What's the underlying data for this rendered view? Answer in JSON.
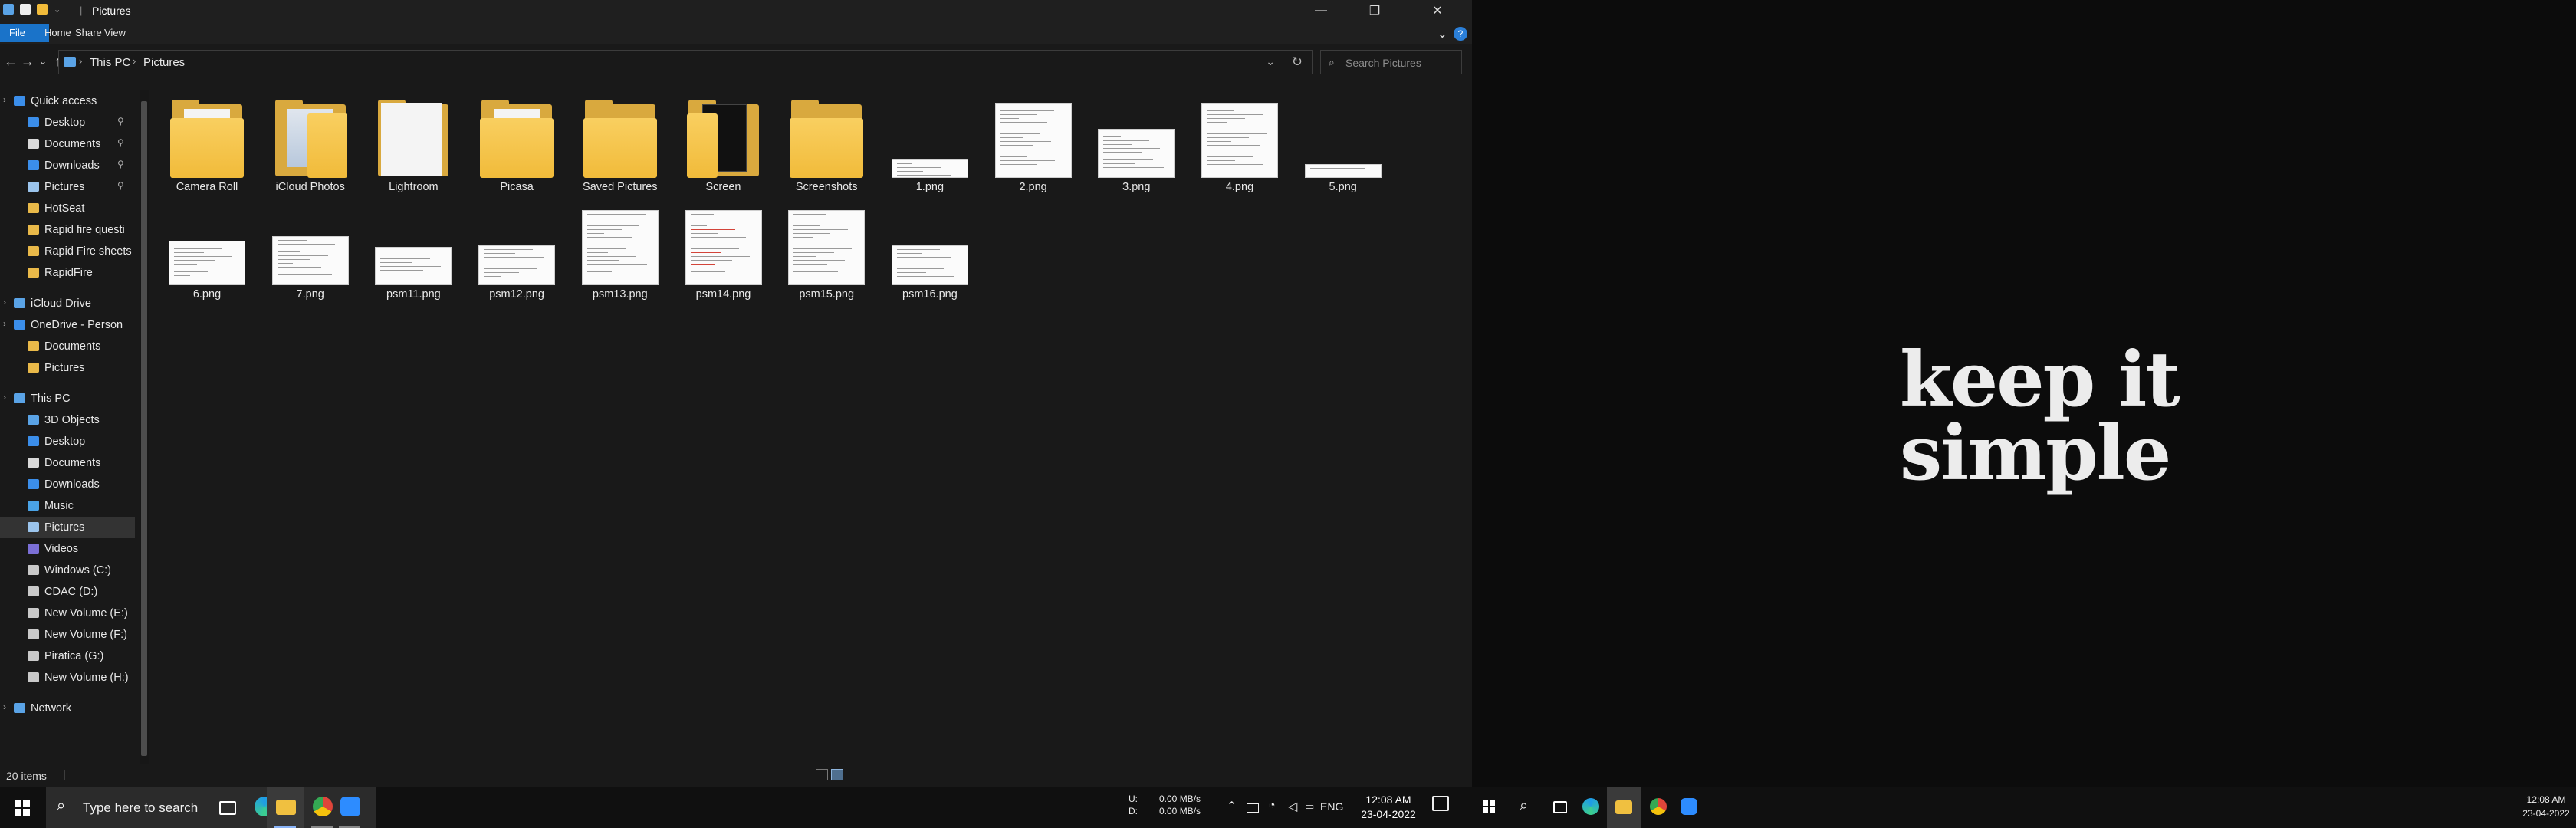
{
  "window": {
    "title": "Pictures",
    "minimize_glyph": "—",
    "maximize_glyph": "❐",
    "close_glyph": "✕"
  },
  "ribbon": {
    "tabs": [
      "File",
      "Home",
      "Share",
      "View"
    ],
    "expand_glyph": "⌄",
    "help_glyph": "?"
  },
  "navigation": {
    "back_glyph": "←",
    "forward_glyph": "→",
    "recent_glyph": "⌄",
    "up_glyph": "↑"
  },
  "address": {
    "crumbs": [
      "This PC",
      "Pictures"
    ],
    "separator": "›",
    "dropdown_glyph": "⌄",
    "refresh_glyph": "↻"
  },
  "search": {
    "placeholder": "Search Pictures",
    "icon_glyph": "⌕"
  },
  "nav_pane": {
    "items": [
      {
        "label": "Quick access",
        "icon": "star-icon",
        "color": "#3b8eea"
      },
      {
        "label": "Desktop",
        "icon": "desktop-icon",
        "color": "#3b8eea",
        "pinned": true
      },
      {
        "label": "Documents",
        "icon": "documents-icon",
        "color": "#d9d9d9",
        "pinned": true
      },
      {
        "label": "Downloads",
        "icon": "downloads-icon",
        "color": "#3b8eea",
        "pinned": true
      },
      {
        "label": "Pictures",
        "icon": "pictures-icon",
        "color": "#9bc4ec",
        "pinned": true
      },
      {
        "label": "HotSeat",
        "icon": "folder-icon",
        "color": "#e9b949"
      },
      {
        "label": "Rapid fire questi",
        "icon": "folder-icon",
        "color": "#e9b949"
      },
      {
        "label": "Rapid Fire sheets",
        "icon": "folder-icon",
        "color": "#e9b949"
      },
      {
        "label": "RapidFire",
        "icon": "folder-icon",
        "color": "#e9b949"
      },
      {
        "label": "iCloud Drive",
        "icon": "icloud-icon",
        "color": "#5aa3e6"
      },
      {
        "label": "OneDrive - Person",
        "icon": "onedrive-icon",
        "color": "#3b8eea"
      },
      {
        "label": "Documents",
        "icon": "folder-icon",
        "color": "#e9b949"
      },
      {
        "label": "Pictures",
        "icon": "folder-icon",
        "color": "#e9b949"
      },
      {
        "label": "This PC",
        "icon": "pc-icon",
        "color": "#5aa3e6"
      },
      {
        "label": "3D Objects",
        "icon": "cube-icon",
        "color": "#5aa3e6"
      },
      {
        "label": "Desktop",
        "icon": "desktop-icon",
        "color": "#3b8eea"
      },
      {
        "label": "Documents",
        "icon": "documents-icon",
        "color": "#d9d9d9"
      },
      {
        "label": "Downloads",
        "icon": "downloads-icon",
        "color": "#3b8eea"
      },
      {
        "label": "Music",
        "icon": "music-icon",
        "color": "#4aa3e6"
      },
      {
        "label": "Pictures",
        "icon": "pictures-icon",
        "color": "#9bc4ec",
        "selected": true
      },
      {
        "label": "Videos",
        "icon": "videos-icon",
        "color": "#7b6fd6"
      },
      {
        "label": "Windows (C:)",
        "icon": "drive-icon",
        "color": "#c9c9c9"
      },
      {
        "label": "CDAC (D:)",
        "icon": "drive-icon",
        "color": "#c9c9c9"
      },
      {
        "label": "New Volume (E:)",
        "icon": "drive-icon",
        "color": "#c9c9c9"
      },
      {
        "label": "New Volume (F:)",
        "icon": "drive-icon",
        "color": "#c9c9c9"
      },
      {
        "label": "Piratica (G:)",
        "icon": "drive-icon",
        "color": "#c9c9c9"
      },
      {
        "label": "New Volume (H:)",
        "icon": "drive-icon",
        "color": "#c9c9c9"
      },
      {
        "label": "Network",
        "icon": "network-icon",
        "color": "#5aa3e6"
      }
    ]
  },
  "files": [
    {
      "name": "Camera Roll",
      "kind": "folder"
    },
    {
      "name": "iCloud Photos",
      "kind": "folder-photos"
    },
    {
      "name": "Lightroom",
      "kind": "folder-doc"
    },
    {
      "name": "Picasa",
      "kind": "folder"
    },
    {
      "name": "Saved Pictures",
      "kind": "folder-plain"
    },
    {
      "name": "Screen",
      "kind": "folder-dark"
    },
    {
      "name": "Screenshots",
      "kind": "folder-plain"
    },
    {
      "name": "1.png",
      "kind": "image"
    },
    {
      "name": "2.png",
      "kind": "image"
    },
    {
      "name": "3.png",
      "kind": "image"
    },
    {
      "name": "4.png",
      "kind": "image"
    },
    {
      "name": "5.png",
      "kind": "image"
    },
    {
      "name": "6.png",
      "kind": "image"
    },
    {
      "name": "7.png",
      "kind": "image"
    },
    {
      "name": "psm11.png",
      "kind": "image"
    },
    {
      "name": "psm12.png",
      "kind": "image"
    },
    {
      "name": "psm13.png",
      "kind": "image"
    },
    {
      "name": "psm14.png",
      "kind": "image-red"
    },
    {
      "name": "psm15.png",
      "kind": "image"
    },
    {
      "name": "psm16.png",
      "kind": "image"
    }
  ],
  "status": {
    "item_count": "20 items",
    "separator": "|"
  },
  "taskbar": {
    "search_placeholder": "Type here to search",
    "apps": [
      {
        "name": "task-view-icon",
        "color": "#ffffff"
      },
      {
        "name": "edge-icon",
        "color": "#1e9be8"
      },
      {
        "name": "file-explorer-icon",
        "color": "#f0c040",
        "active": true
      },
      {
        "name": "chrome-icon",
        "color": "#e0453a"
      },
      {
        "name": "zoom-icon",
        "color": "#2d8cff"
      }
    ],
    "net_upload_label": "U:",
    "net_upload_value": "0.00 MB/s",
    "net_download_label": "D:",
    "net_download_value": "0.00 MB/s",
    "language": "ENG",
    "time": "12:08 AM",
    "date": "23-04-2022"
  },
  "second_monitor": {
    "wallpaper_line1": "keep it",
    "wallpaper_line2": "simple",
    "time": "12:08 AM",
    "date": "23-04-2022"
  }
}
